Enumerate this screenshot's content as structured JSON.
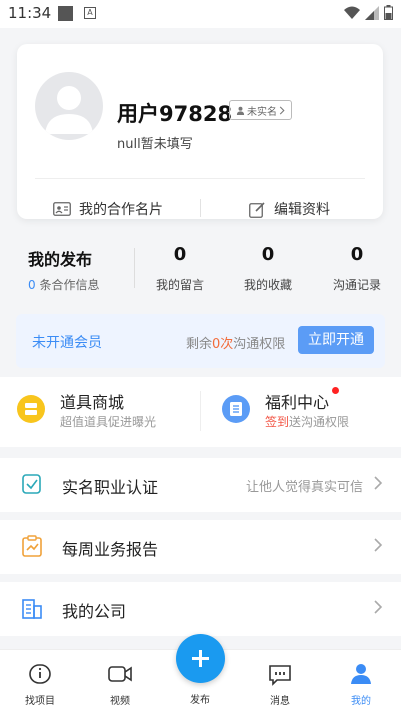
{
  "status_bar": {
    "time": "11:34"
  },
  "profile": {
    "username": "用户97828",
    "verify_badge": "未实名",
    "bio": "null暂未填写",
    "card_button": "我的合作名片",
    "edit_button": "编辑资料"
  },
  "stats": {
    "title": "我的发布",
    "sub_count": "0",
    "sub_text": "条合作信息",
    "items": [
      {
        "num": "0",
        "label": "我的留言"
      },
      {
        "num": "0",
        "label": "我的收藏"
      },
      {
        "num": "0",
        "label": "沟通记录"
      }
    ]
  },
  "vip": {
    "status": "未开通会员",
    "remain_prefix": "剩余",
    "remain_count": "0次",
    "remain_suffix": "沟通权限",
    "button": "立即开通"
  },
  "tools": {
    "shop_title": "道具商城",
    "shop_sub": "超值道具促进曝光",
    "welfare_title": "福利中心",
    "welfare_sub_red": "签到",
    "welfare_sub": "送沟通权限"
  },
  "rows": [
    {
      "label": "实名职业认证",
      "hint": "让他人觉得真实可信"
    },
    {
      "label": "每周业务报告",
      "hint": ""
    },
    {
      "label": "我的公司",
      "hint": ""
    }
  ],
  "tabbar": {
    "items": [
      {
        "label": "找项目"
      },
      {
        "label": "视频"
      },
      {
        "label": "发布"
      },
      {
        "label": "消息"
      },
      {
        "label": "我的"
      }
    ]
  },
  "colors": {
    "accent": "#3b8cf5",
    "fab": "#1a9af0",
    "warn": "#f26b3a"
  }
}
